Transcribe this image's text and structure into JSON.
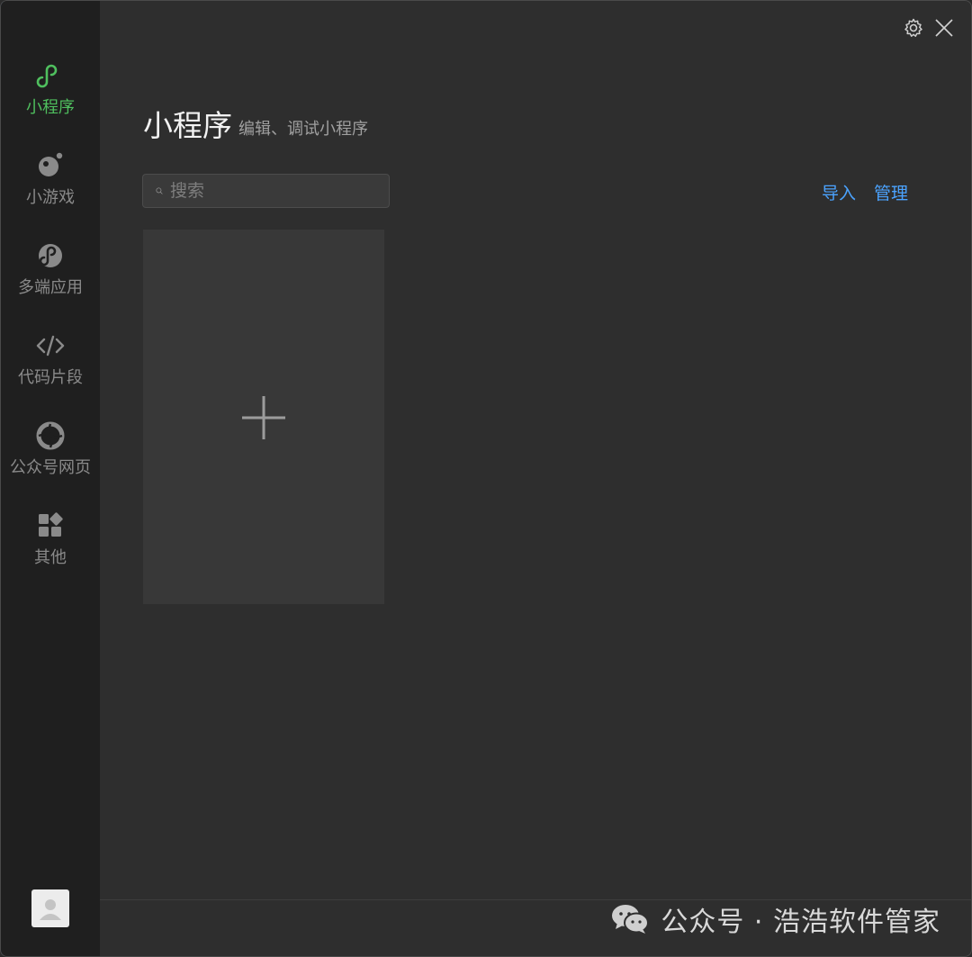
{
  "sidebar": {
    "items": [
      {
        "label": "小程序",
        "icon": "mini-program-icon",
        "active": true
      },
      {
        "label": "小游戏",
        "icon": "mini-game-icon",
        "active": false
      },
      {
        "label": "多端应用",
        "icon": "multi-platform-icon",
        "active": false
      },
      {
        "label": "代码片段",
        "icon": "code-snippet-icon",
        "active": false
      },
      {
        "label": "公众号网页",
        "icon": "official-account-web-icon",
        "active": false
      },
      {
        "label": "其他",
        "icon": "other-apps-icon",
        "active": false
      }
    ],
    "active_color": "#4fbf5e"
  },
  "header": {
    "title": "小程序",
    "subtitle": "编辑、调试小程序"
  },
  "search": {
    "placeholder": "搜索"
  },
  "actions": {
    "import_label": "导入",
    "manage_label": "管理",
    "link_color": "#4ba3ff"
  },
  "watermark": {
    "text": "公众号 · 浩浩软件管家"
  }
}
